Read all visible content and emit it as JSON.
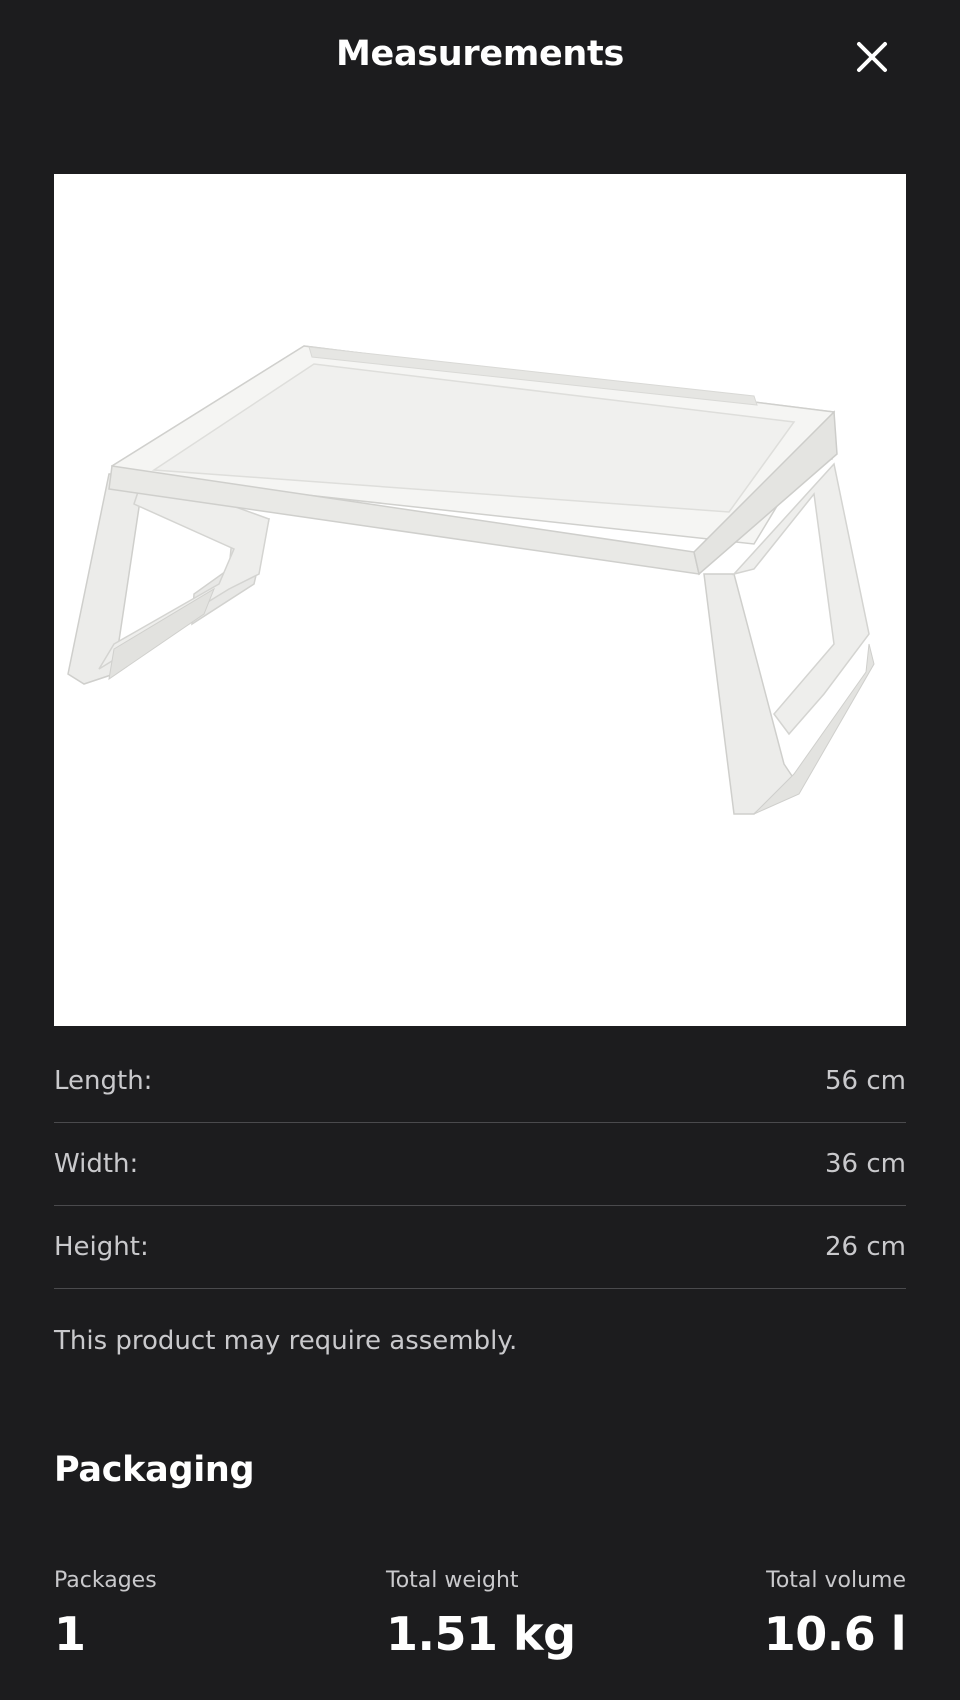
{
  "header": {
    "title": "Measurements",
    "close_icon": "close-icon"
  },
  "product_image": {
    "icon": "bed-tray-table-image"
  },
  "dimensions": [
    {
      "label": "Length:",
      "value": "56 cm"
    },
    {
      "label": "Width:",
      "value": "36 cm"
    },
    {
      "label": "Height:",
      "value": "26 cm"
    }
  ],
  "assembly_note": "This product may require assembly.",
  "packaging": {
    "title": "Packaging",
    "stats": [
      {
        "label": "Packages",
        "value": "1"
      },
      {
        "label": "Total weight",
        "value": "1.51 kg"
      },
      {
        "label": "Total volume",
        "value": "10.6 l"
      }
    ]
  },
  "colors": {
    "background": "#1c1c1e",
    "text_primary": "#ffffff",
    "text_secondary": "#c9c9cc",
    "divider": "#4a4a4d"
  }
}
